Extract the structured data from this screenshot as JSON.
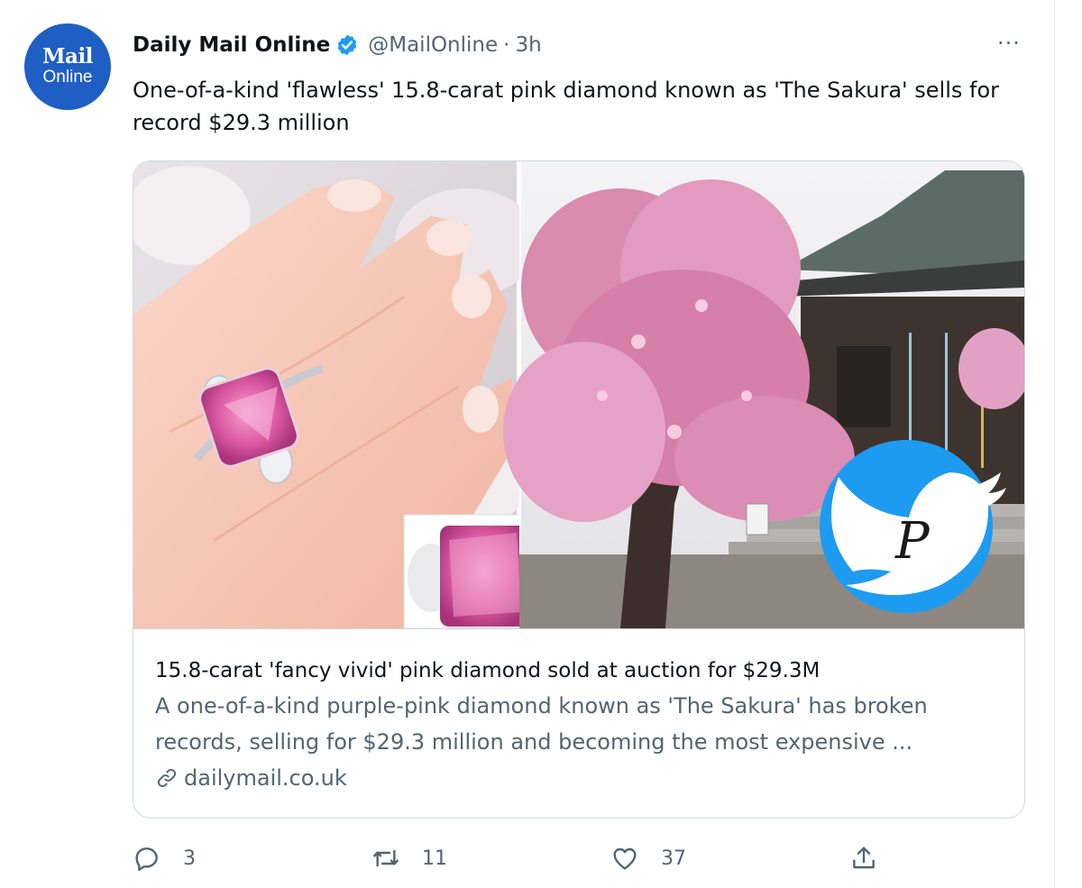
{
  "tweet": {
    "author_name": "Daily Mail Online",
    "handle": "@MailOnline",
    "separator": "·",
    "time": "3h",
    "more_label": "···",
    "avatar_line1": "Mail",
    "avatar_line2": "Online",
    "text": "One-of-a-kind 'flawless' 15.8-carat pink diamond known as 'The Sakura' sells for record $29.3 million"
  },
  "card": {
    "title": "15.8-carat 'fancy vivid' pink diamond sold at auction for $29.3M",
    "description": "A one-of-a-kind purple-pink diamond known as 'The Sakura' has broken records, selling for $29.3 million and becoming the most expensive ...",
    "domain": "dailymail.co.uk",
    "watermark_letter": "P"
  },
  "actions": {
    "replies": "3",
    "retweets": "11",
    "likes": "37"
  },
  "colors": {
    "twitter_blue": "#1d9bf0",
    "avatar_blue": "#1f5fc4",
    "text_secondary": "#536471"
  },
  "icons": [
    "verified-badge-icon",
    "more-icon",
    "link-icon",
    "reply-icon",
    "retweet-icon",
    "like-icon",
    "share-icon"
  ]
}
